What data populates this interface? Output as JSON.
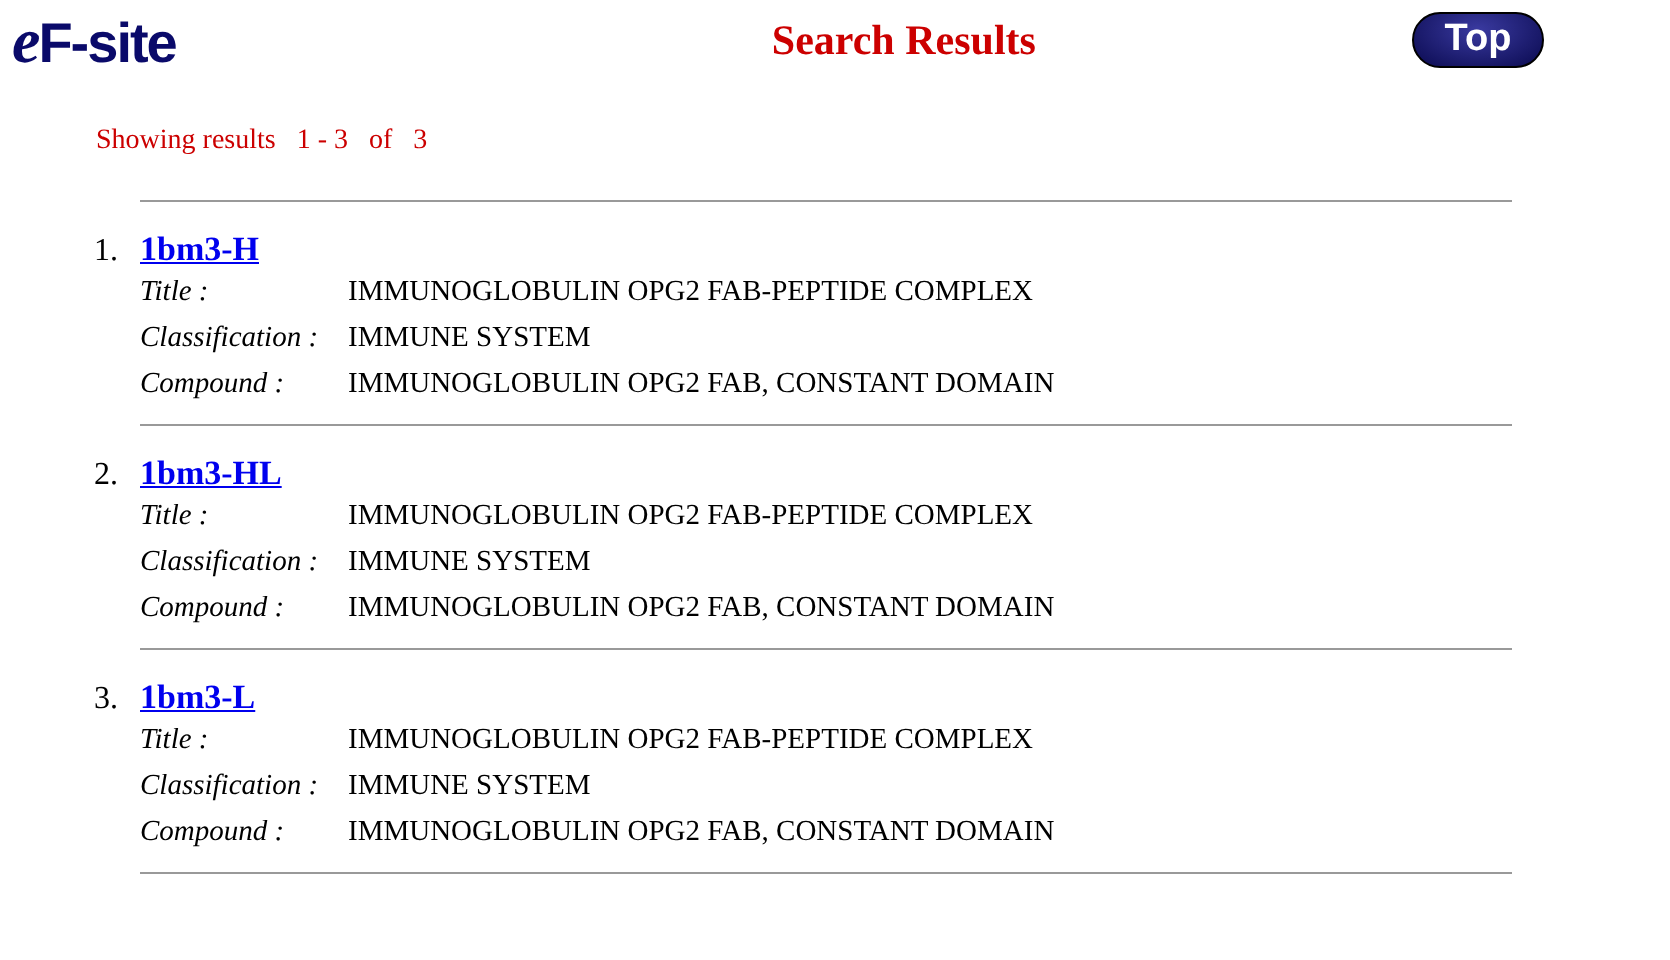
{
  "header": {
    "logo_prefix": "e",
    "logo_main": "F-site",
    "title": "Search Results",
    "top_button": "Top"
  },
  "summary": "Showing results   1 - 3   of   3",
  "results": [
    {
      "number": "1.",
      "id": "1bm3-H",
      "fields": [
        {
          "label": "Title :",
          "value": "IMMUNOGLOBULIN OPG2 FAB-PEPTIDE COMPLEX"
        },
        {
          "label": "Classification :",
          "value": "IMMUNE SYSTEM"
        },
        {
          "label": "Compound :",
          "value": "IMMUNOGLOBULIN OPG2 FAB, CONSTANT DOMAIN"
        }
      ]
    },
    {
      "number": "2.",
      "id": "1bm3-HL",
      "fields": [
        {
          "label": "Title :",
          "value": "IMMUNOGLOBULIN OPG2 FAB-PEPTIDE COMPLEX"
        },
        {
          "label": "Classification :",
          "value": "IMMUNE SYSTEM"
        },
        {
          "label": "Compound :",
          "value": "IMMUNOGLOBULIN OPG2 FAB, CONSTANT DOMAIN"
        }
      ]
    },
    {
      "number": "3.",
      "id": "1bm3-L",
      "fields": [
        {
          "label": "Title :",
          "value": "IMMUNOGLOBULIN OPG2 FAB-PEPTIDE COMPLEX"
        },
        {
          "label": "Classification :",
          "value": "IMMUNE SYSTEM"
        },
        {
          "label": "Compound :",
          "value": "IMMUNOGLOBULIN OPG2 FAB, CONSTANT DOMAIN"
        }
      ]
    }
  ]
}
